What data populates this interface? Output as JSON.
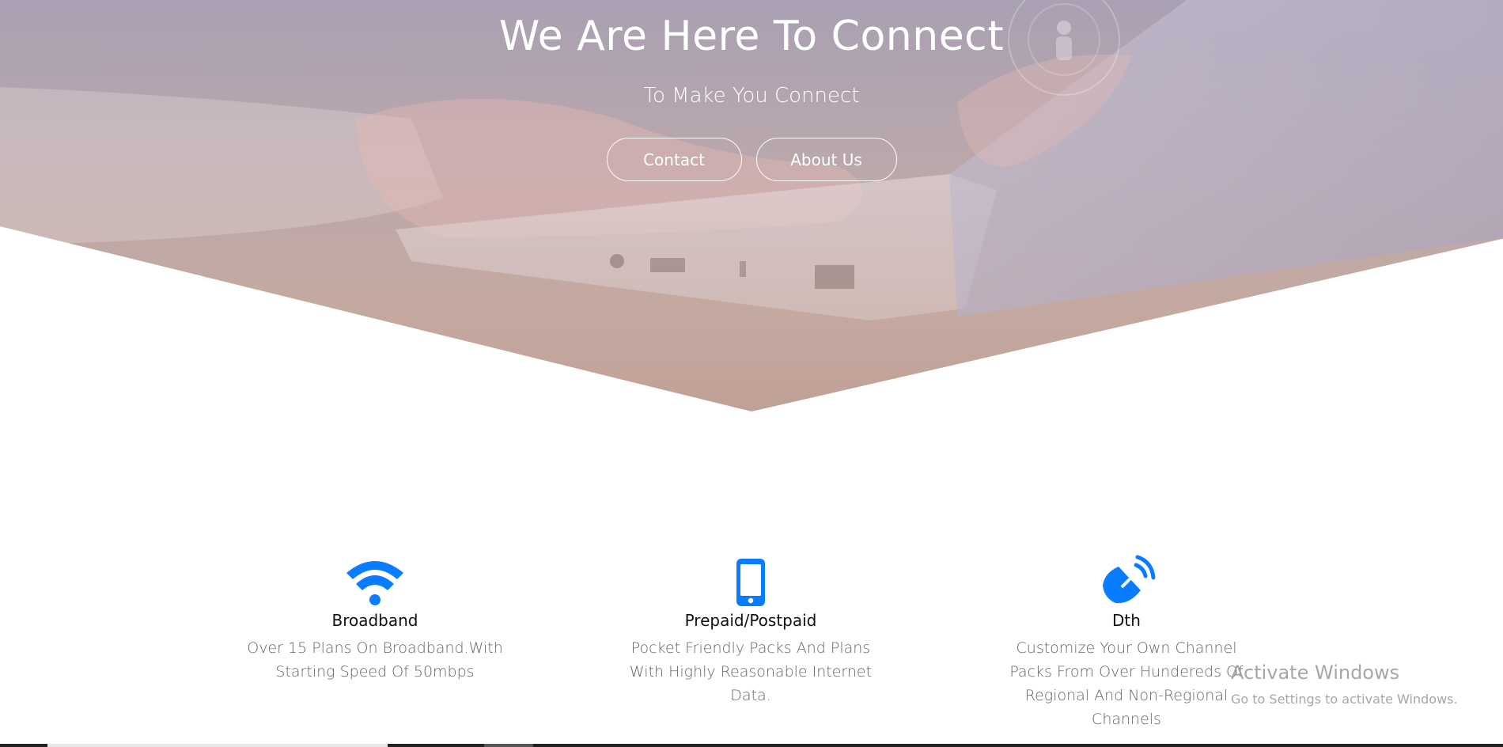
{
  "hero": {
    "title": "We Are Here To Connect",
    "subtitle": "To Make You Connect",
    "buttons": {
      "contact": "Contact",
      "about": "About Us"
    }
  },
  "services": [
    {
      "icon": "wifi-icon",
      "title": "Broadband",
      "description": "Over 15 Plans On Broadband.With Starting Speed Of 50mbps"
    },
    {
      "icon": "mobile-phone-icon",
      "title": "Prepaid/Postpaid",
      "description": "Pocket Friendly Packs And Plans With Highly Reasonable Internet Data."
    },
    {
      "icon": "satellite-dish-icon",
      "title": "Dth",
      "description": "Customize Your Own Channel Packs From Over Hundereds Of Regional And Non-Regional Channels"
    }
  ],
  "watermark": {
    "title": "Activate Windows",
    "subtitle": "Go to Settings to activate Windows."
  },
  "colors": {
    "accent": "#0a7cff",
    "hero_overlay": "#b8a0a8",
    "text_dark": "#111111",
    "text_muted": "#666666"
  }
}
